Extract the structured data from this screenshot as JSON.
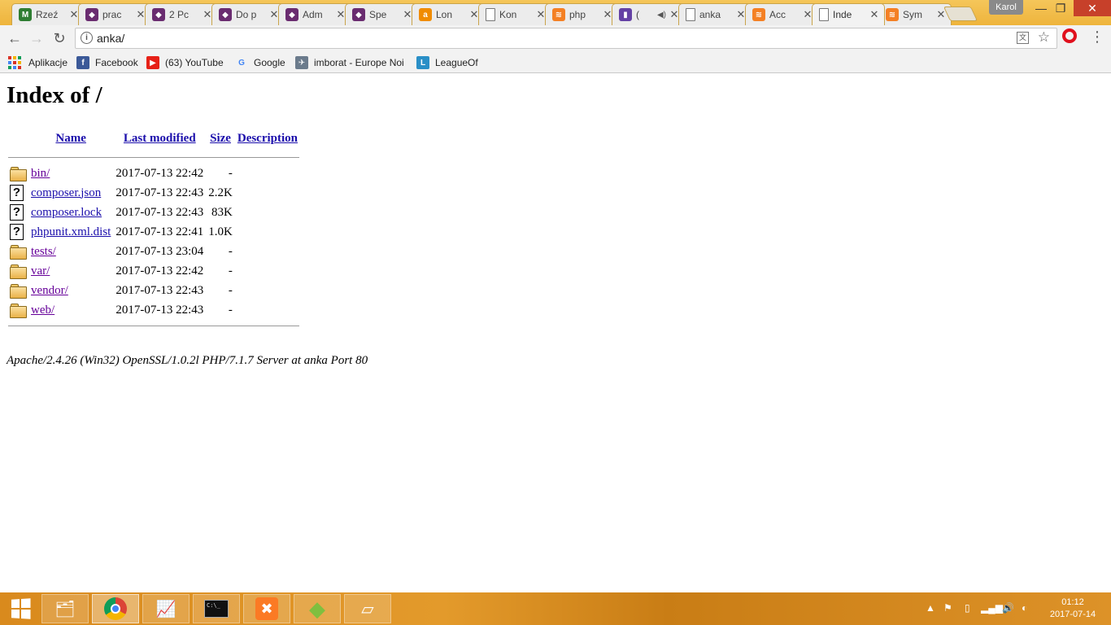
{
  "tabs": [
    {
      "title": "Rzeź",
      "icon": "maps-icon",
      "color": "#2e7d32",
      "glyph": "M"
    },
    {
      "title": "prac",
      "icon": "tile-icon",
      "color": "#6a2c70",
      "glyph": "◆"
    },
    {
      "title": "2 Pc",
      "icon": "tile-icon",
      "color": "#6a2c70",
      "glyph": "◆"
    },
    {
      "title": "Do p",
      "icon": "tile-icon",
      "color": "#6a2c70",
      "glyph": "◆"
    },
    {
      "title": "Adm",
      "icon": "tile-icon",
      "color": "#6a2c70",
      "glyph": "◆"
    },
    {
      "title": "Spe",
      "icon": "tile-icon",
      "color": "#6a2c70",
      "glyph": "◆"
    },
    {
      "title": "Lon",
      "icon": "amazon-icon",
      "color": "#f08c00",
      "glyph": "a"
    },
    {
      "title": "Kon",
      "icon": "page-icon",
      "color": "#ffffff",
      "glyph": ""
    },
    {
      "title": "php",
      "icon": "stackoverflow-icon",
      "color": "#f48024",
      "glyph": "≋"
    },
    {
      "title": "(",
      "icon": "twitch-icon",
      "color": "#6441a5",
      "glyph": "▮",
      "muted": true
    },
    {
      "title": "anka",
      "icon": "page-icon",
      "color": "#ffffff",
      "glyph": ""
    },
    {
      "title": "Acc",
      "icon": "stackoverflow-icon",
      "color": "#f48024",
      "glyph": "≋"
    },
    {
      "title": "Inde",
      "icon": "page-icon",
      "color": "#ffffff",
      "glyph": "",
      "active": true
    },
    {
      "title": "Sym",
      "icon": "stackoverflow-icon",
      "color": "#f48024",
      "glyph": "≋"
    }
  ],
  "tab_close_glyph": "✕",
  "mute_glyph": "◀)",
  "user": {
    "name": "Karol"
  },
  "window_controls": {
    "minimize": "—",
    "maximize": "❐",
    "close": "✕"
  },
  "toolbar": {
    "back": "←",
    "forward": "→",
    "reload": "↻",
    "url": "anka/",
    "info_glyph": "i",
    "translate_glyph": "文",
    "star_glyph": "☆",
    "menu_glyph": "⋮"
  },
  "bookmarks": [
    {
      "label": "Aplikacje",
      "icon": "apps-grid-icon"
    },
    {
      "label": "Facebook",
      "icon": "facebook-icon",
      "color": "#3b5998",
      "glyph": "f"
    },
    {
      "label": "(63) YouTube",
      "icon": "youtube-icon",
      "color": "#e62117",
      "glyph": "▶"
    },
    {
      "label": "Google",
      "icon": "google-icon",
      "color": "#4285f4",
      "glyph": "G"
    },
    {
      "label": "imborat - Europe Noi",
      "icon": "imborat-icon",
      "color": "#6b7b8c",
      "glyph": "✈"
    },
    {
      "label": "LeagueOf",
      "icon": "leagueof-icon",
      "color": "#2a8fc7",
      "glyph": "L"
    }
  ],
  "page": {
    "heading": "Index of /",
    "columns": {
      "name": "Name",
      "modified": "Last modified",
      "size": "Size",
      "description": "Description"
    },
    "entries": [
      {
        "name": "bin/",
        "modified": "2017-07-13 22:42",
        "size": "-",
        "type": "folder",
        "visited": true
      },
      {
        "name": "composer.json",
        "modified": "2017-07-13 22:43",
        "size": "2.2K",
        "type": "file",
        "visited": false
      },
      {
        "name": "composer.lock",
        "modified": "2017-07-13 22:43",
        "size": "83K",
        "type": "file",
        "visited": false
      },
      {
        "name": "phpunit.xml.dist",
        "modified": "2017-07-13 22:41",
        "size": "1.0K",
        "type": "file",
        "visited": false
      },
      {
        "name": "tests/",
        "modified": "2017-07-13 23:04",
        "size": "-",
        "type": "folder",
        "visited": true
      },
      {
        "name": "var/",
        "modified": "2017-07-13 22:42",
        "size": "-",
        "type": "folder",
        "visited": true
      },
      {
        "name": "vendor/",
        "modified": "2017-07-13 22:43",
        "size": "-",
        "type": "folder",
        "visited": true
      },
      {
        "name": "web/",
        "modified": "2017-07-13 22:43",
        "size": "-",
        "type": "folder",
        "visited": true
      }
    ],
    "unknown_file_glyph": "?",
    "footer": "Apache/2.4.26 (Win32) OpenSSL/1.0.2l PHP/7.1.7 Server at anka Port 80"
  },
  "taskbar": {
    "items": [
      {
        "name": "file-explorer-icon",
        "glyph": "🗂",
        "state": "pinned"
      },
      {
        "name": "chrome-icon",
        "glyph": "",
        "state": "running"
      },
      {
        "name": "resource-monitor-icon",
        "glyph": "📈",
        "state": "pinned"
      },
      {
        "name": "command-prompt-icon",
        "glyph": "C:\\_",
        "state": "pinned"
      },
      {
        "name": "xampp-icon",
        "glyph": "✖",
        "state": "pinned"
      },
      {
        "name": "diamond-app-icon",
        "glyph": "◆",
        "state": "pinned"
      },
      {
        "name": "notepad-icon",
        "glyph": "▱",
        "state": "pinned"
      }
    ],
    "tray": {
      "show_hidden": "▲",
      "flag": "⚑",
      "battery": "▯",
      "signal": "▂▄▆",
      "volume": "🔊",
      "network": "◐"
    },
    "time": "01:12",
    "date": "2017-07-14"
  }
}
